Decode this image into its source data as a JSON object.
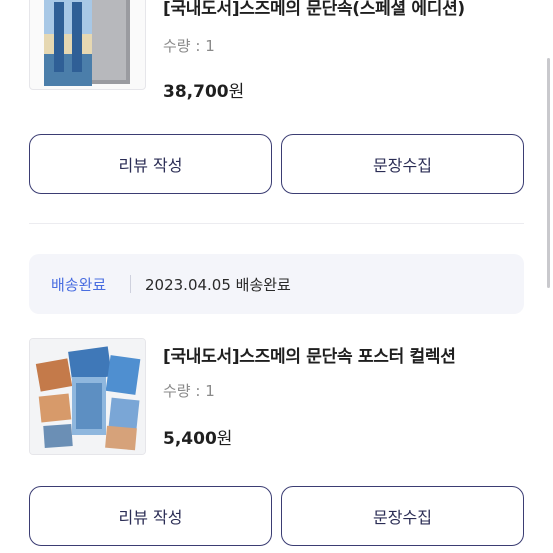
{
  "orders": [
    {
      "item": {
        "title": "[국내도서]스즈메의 문단속(스페셜 에디션)",
        "quantity": "수량 : 1",
        "price_number": "38,700",
        "price_unit": "원"
      },
      "buttons": {
        "review": "리뷰 작성",
        "quote": "문장수집"
      }
    },
    {
      "status": {
        "label": "배송완료",
        "detail": "2023.04.05 배송완료"
      },
      "item": {
        "title": "[국내도서]스즈메의 문단속 포스터 컬렉션",
        "quantity": "수량 : 1",
        "price_number": "5,400",
        "price_unit": "원"
      },
      "buttons": {
        "review": "리뷰 작성",
        "quote": "문장수집"
      }
    }
  ],
  "colors": {
    "button_border": "#3b3d73",
    "status_accent": "#4a6ee0",
    "status_background": "#f4f5fa"
  },
  "icons": [
    "book-cover-image",
    "poster-collection-image"
  ]
}
